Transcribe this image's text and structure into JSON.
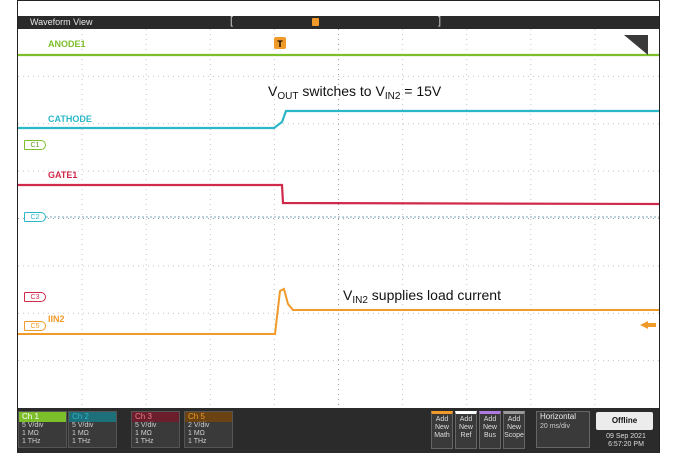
{
  "window": {
    "title": "Waveform View",
    "bracket_left": "[",
    "bracket_right": "]"
  },
  "trigger": {
    "label": "T"
  },
  "colors": {
    "ch1": "#7cbf2a",
    "ch2": "#2ab7c8",
    "ch3": "#d02a4a",
    "ch5": "#f09a2a",
    "ref": "#cfcfcf"
  },
  "channels": [
    {
      "id": "ch1",
      "name": "ANODE1"
    },
    {
      "id": "ch2",
      "name": "CATHODE",
      "chip": "C1"
    },
    {
      "id": "ch3",
      "name": "GATE1",
      "chip": "C2"
    },
    {
      "id": "ch5",
      "name": "IIN2",
      "chip": "C5"
    },
    {
      "id": "ref",
      "chip": "C3"
    }
  ],
  "annotations": {
    "vout": {
      "pre": "V",
      "sub1": "OUT",
      "mid": " switches to V",
      "sub2": "IN2",
      "post": " = 15V"
    },
    "vin": {
      "pre": "V",
      "sub1": "IN2",
      "post": " supplies load current"
    }
  },
  "status": {
    "channel_boxes": [
      {
        "name": "Ch 1",
        "vdiv": "5 V/div",
        "imp": "1 MΩ",
        "bw": "1 THz"
      },
      {
        "name": "Ch 2",
        "vdiv": "5 V/div",
        "imp": "1 MΩ",
        "bw": "1 THz"
      },
      {
        "name": "Ch 3",
        "vdiv": "5 V/div",
        "imp": "1 MΩ",
        "bw": "1 THz"
      },
      {
        "name": "Ch 5",
        "vdiv": "2 V/div",
        "imp": "1 MΩ",
        "bw": "1 THz"
      }
    ],
    "add_buttons": [
      {
        "l1": "Add",
        "l2": "New",
        "l3": "Math"
      },
      {
        "l1": "Add",
        "l2": "New",
        "l3": "Ref"
      },
      {
        "l1": "Add",
        "l2": "New",
        "l3": "Bus"
      },
      {
        "l1": "Add",
        "l2": "New",
        "l3": "Scope"
      }
    ],
    "horizontal": {
      "title": "Horizontal",
      "scale": "20 ms/div"
    },
    "offline_label": "Offline",
    "date": "09 Sep 2021",
    "time": "6:57:20 PM"
  }
}
